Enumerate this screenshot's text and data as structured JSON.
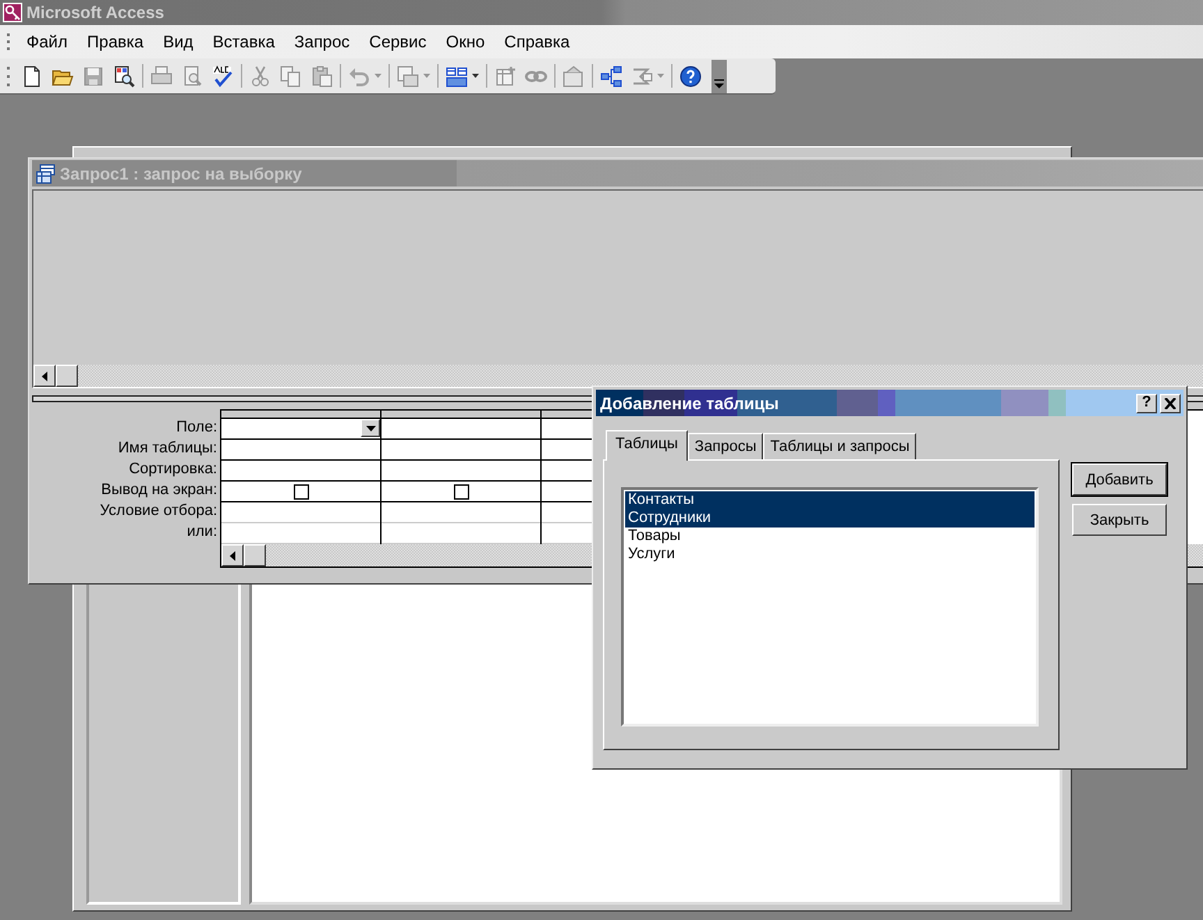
{
  "app_title": "Microsoft Access",
  "menu": [
    "Файл",
    "Правка",
    "Вид",
    "Вставка",
    "Запрос",
    "Сервис",
    "Окно",
    "Справка"
  ],
  "toolbar": [
    {
      "disabled": false
    },
    {
      "disabled": false
    },
    {
      "disabled": true
    },
    {
      "disabled": false
    },
    {
      "disabled": true
    },
    {
      "disabled": true
    },
    {
      "disabled": false
    },
    {
      "disabled": true
    },
    {
      "disabled": true
    },
    {
      "disabled": true
    },
    {
      "disabled": true
    },
    {
      "disabled": true
    },
    {
      "disabled": false
    },
    {
      "disabled": true
    },
    {
      "disabled": true
    },
    {
      "disabled": true
    },
    {
      "disabled": false
    },
    {
      "disabled": true
    },
    {
      "disabled": false
    }
  ],
  "query_window": {
    "title": "Запрос1 : запрос на выборку",
    "grid": {
      "row_labels": [
        "Поле:",
        "Имя таблицы:",
        "Сортировка:",
        "Вывод на экран:",
        "Условие отбора:",
        "или:"
      ],
      "columns": [
        {
          "active": true,
          "show_checked": false
        },
        {
          "active": false,
          "show_checked": false
        }
      ]
    }
  },
  "dialog": {
    "title": "Добавление таблицы",
    "help_button": "?",
    "tabs": [
      {
        "label": "Таблицы",
        "selected": true
      },
      {
        "label": "Запросы",
        "selected": false
      },
      {
        "label": "Таблицы и запросы",
        "selected": false
      }
    ],
    "list": [
      {
        "label": "Контакты",
        "selected": true
      },
      {
        "label": "Сотрудники",
        "selected": true
      },
      {
        "label": "Товары",
        "selected": false
      },
      {
        "label": "Услуги",
        "selected": false
      }
    ],
    "buttons": [
      {
        "label": "Добавить",
        "default": true
      },
      {
        "label": "Закрыть",
        "default": false
      }
    ]
  }
}
